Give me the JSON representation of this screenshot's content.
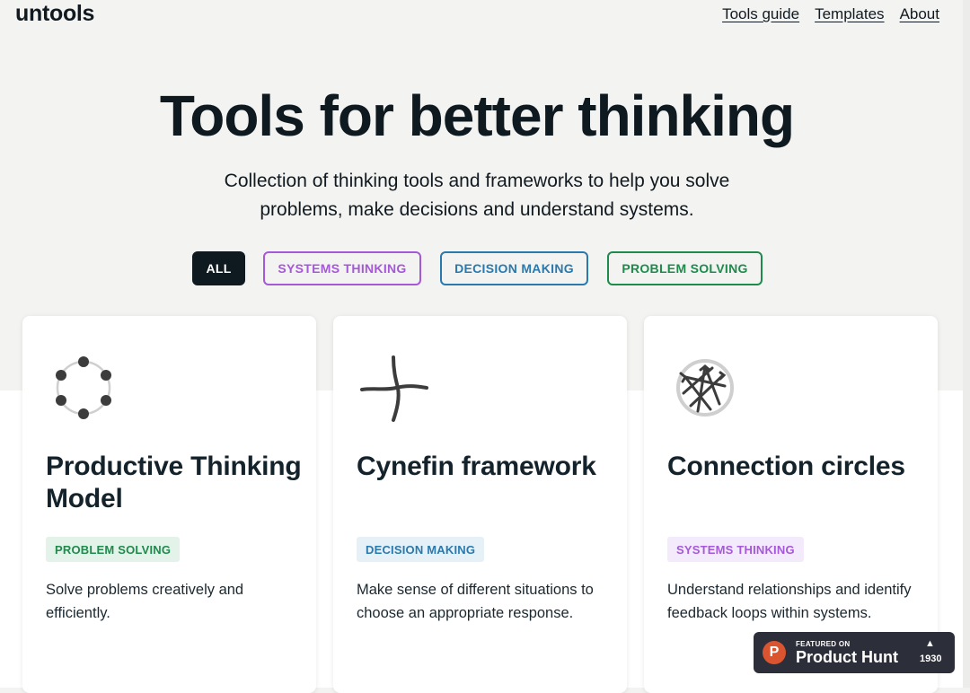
{
  "header": {
    "logo": "untools",
    "nav": [
      "Tools guide",
      "Templates",
      "About"
    ]
  },
  "hero": {
    "title": "Tools for better thinking",
    "subtitle": "Collection of thinking tools and frameworks to help you solve problems, make decisions and understand systems."
  },
  "filters": [
    {
      "label": "ALL",
      "selected": true
    },
    {
      "label": "SYSTEMS THINKING",
      "color": "#a558d8"
    },
    {
      "label": "DECISION MAKING",
      "color": "#2a79ad"
    },
    {
      "label": "PROBLEM SOLVING",
      "color": "#1e8a4c"
    }
  ],
  "cards": [
    {
      "icon": "circle-of-dots-icon",
      "title": "Productive Thinking Model",
      "tag": "PROBLEM SOLVING",
      "description": "Solve problems creatively and efficiently."
    },
    {
      "icon": "cross-quadrants-icon",
      "title": "Cynefin framework",
      "tag": "DECISION MAKING",
      "description": "Make sense of different situations to choose an appropriate response."
    },
    {
      "icon": "connection-circle-icon",
      "title": "Connection circles",
      "tag": "SYSTEMS THINKING",
      "description": "Understand relationships and identify feedback loops within systems."
    }
  ],
  "product_hunt": {
    "logo_letter": "P",
    "featured": "FEATURED ON",
    "name": "Product Hunt",
    "arrow": "▲",
    "count": "1930"
  },
  "colors": {
    "background": "#f3f3f1",
    "text": "#111a20",
    "systems": "#a558d8",
    "decision": "#2a79ad",
    "problem": "#1e8a4c",
    "product_hunt": "#da552f"
  }
}
